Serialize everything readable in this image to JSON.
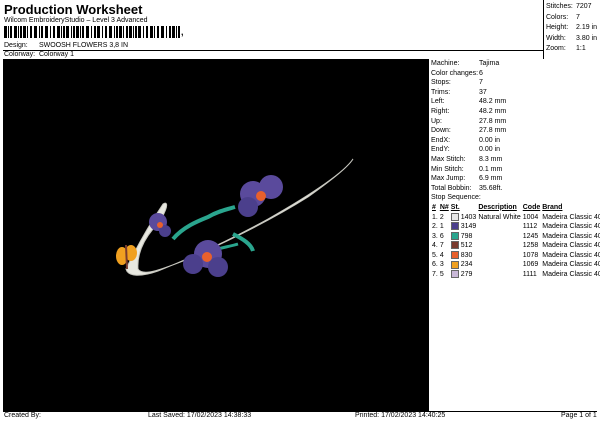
{
  "header": {
    "title": "Production Worksheet",
    "subtitle": "Wilcom EmbroideryStudio – Level 3 Advanced",
    "barcode_suffix": ","
  },
  "meta": {
    "design_label": "Design:",
    "design_value": "SWOOSH FLOWERS 3,8 IN",
    "colorway_label": "Colorway:",
    "colorway_value": "Colorway 1"
  },
  "stats": [
    {
      "label": "Stitches:",
      "value": "7207"
    },
    {
      "label": "Colors:",
      "value": "7"
    },
    {
      "label": "Height:",
      "value": "2.19 in"
    },
    {
      "label": "Width:",
      "value": "3.80 in"
    },
    {
      "label": "Zoom:",
      "value": "1:1"
    }
  ],
  "info": [
    {
      "label": "Machine:",
      "value": "Tajima"
    },
    {
      "label": "Color changes:",
      "value": "6"
    },
    {
      "label": "Stops:",
      "value": "7"
    },
    {
      "label": "Trims:",
      "value": "37"
    },
    {
      "label": "Left:",
      "value": "48.2 mm"
    },
    {
      "label": "Right:",
      "value": "48.2 mm"
    },
    {
      "label": "Up:",
      "value": "27.8 mm"
    },
    {
      "label": "Down:",
      "value": "27.8 mm"
    },
    {
      "label": "EndX:",
      "value": "0.00 in"
    },
    {
      "label": "EndY:",
      "value": "0.00 in"
    },
    {
      "label": "Max Stitch:",
      "value": "8.3 mm"
    },
    {
      "label": "Min Stitch:",
      "value": "0.1 mm"
    },
    {
      "label": "Max Jump:",
      "value": "6.9 mm"
    },
    {
      "label": "Total Bobbin:",
      "value": "35.68ft."
    }
  ],
  "sequence": {
    "label": "Stop Sequence:",
    "headers": [
      "#",
      "N#",
      "St.",
      "Description",
      "Code",
      "Brand"
    ],
    "rows": [
      {
        "num": "1.",
        "n": "2",
        "color": "#e8e8e8",
        "st": "1403",
        "desc": "Natural White",
        "code": "1004",
        "brand": "Madeira Classic 40"
      },
      {
        "num": "2.",
        "n": "1",
        "color": "#4b3f8c",
        "st": "3149",
        "desc": "",
        "code": "1112",
        "brand": "Madeira Classic 40"
      },
      {
        "num": "3.",
        "n": "6",
        "color": "#2aa58e",
        "st": "798",
        "desc": "",
        "code": "1245",
        "brand": "Madeira Classic 40"
      },
      {
        "num": "4.",
        "n": "7",
        "color": "#7a3b2e",
        "st": "512",
        "desc": "",
        "code": "1258",
        "brand": "Madeira Classic 40"
      },
      {
        "num": "5.",
        "n": "4",
        "color": "#e8602c",
        "st": "830",
        "desc": "",
        "code": "1078",
        "brand": "Madeira Classic 40"
      },
      {
        "num": "6.",
        "n": "3",
        "color": "#f0a020",
        "st": "234",
        "desc": "",
        "code": "1069",
        "brand": "Madeira Classic 40"
      },
      {
        "num": "7.",
        "n": "5",
        "color": "#c9b8d8",
        "st": "279",
        "desc": "",
        "code": "1111",
        "brand": "Madeira Classic 40"
      }
    ]
  },
  "footer": {
    "created_by": "Created By:",
    "last_saved": "Last Saved: 17/02/2023 14:38:33",
    "printed": "Printed: 17/02/2023 14:40:25",
    "page": "Page 1 of 1"
  }
}
